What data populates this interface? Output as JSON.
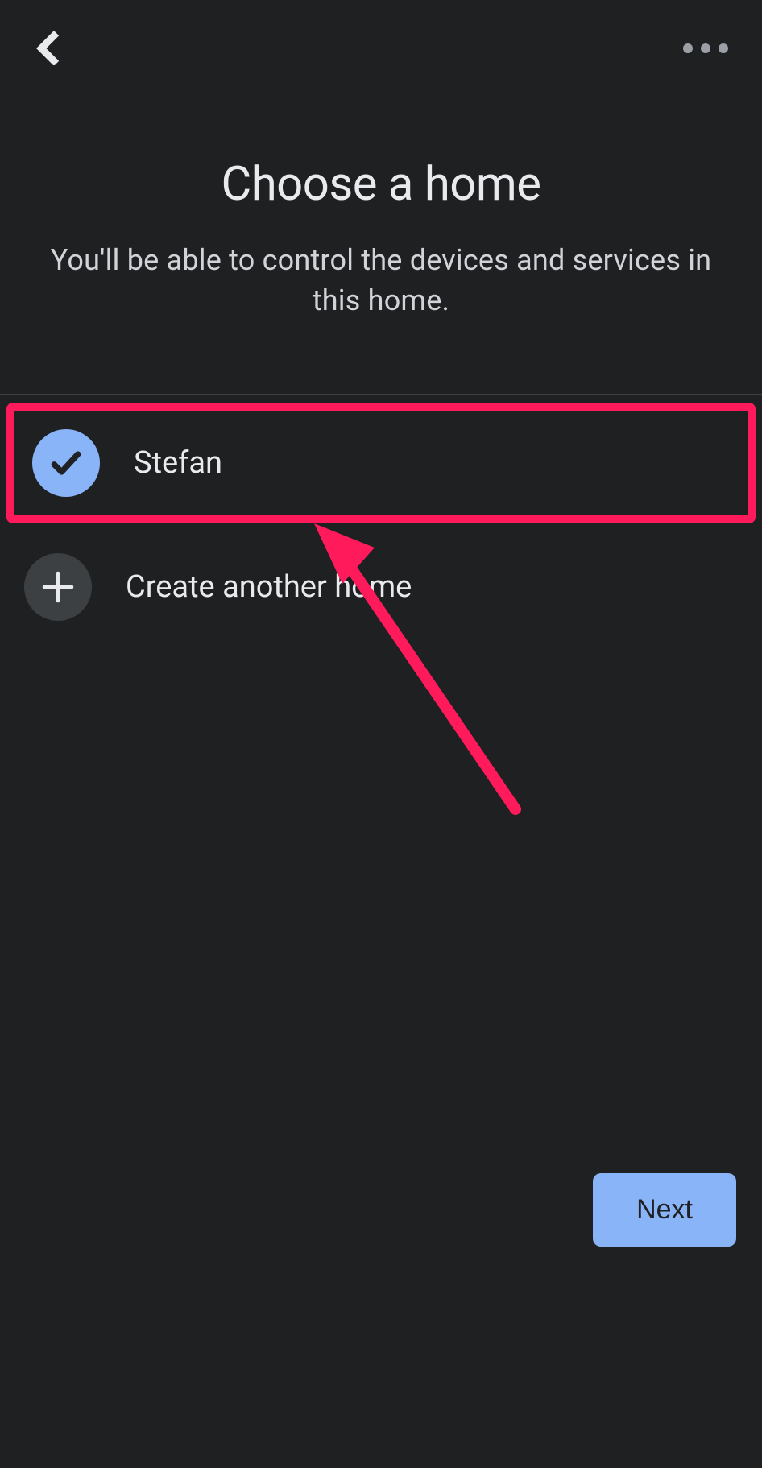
{
  "header": {
    "title": "Choose a home",
    "subtitle": "You'll be able to control the devices and services in this home."
  },
  "homes": [
    {
      "label": "Stefan",
      "selected": true
    }
  ],
  "create_row": {
    "label": "Create another home"
  },
  "footer": {
    "next_label": "Next"
  },
  "colors": {
    "accent": "#8ab4f8",
    "highlight": "#ff1a5b",
    "bg": "#1f2022"
  }
}
